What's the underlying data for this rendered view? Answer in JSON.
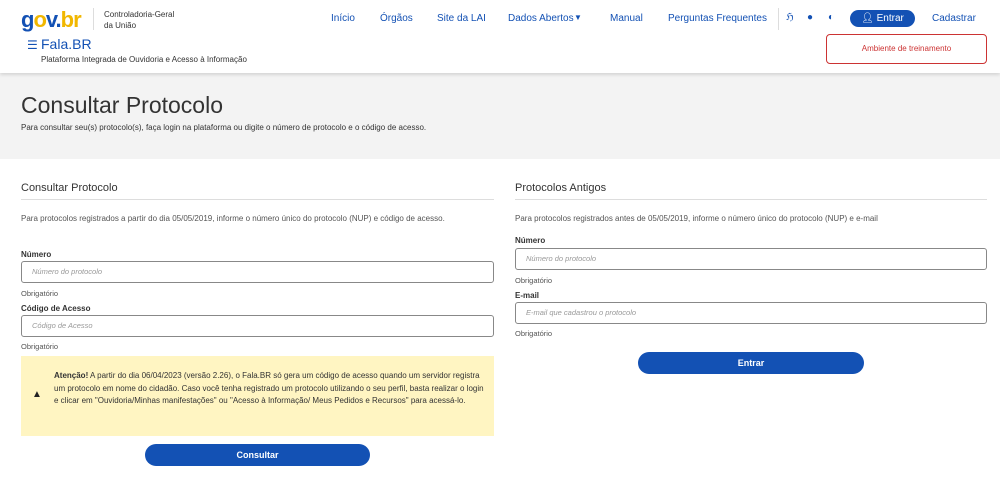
{
  "header": {
    "logo": "gov.br",
    "org_line1": "Controladoria-Geral",
    "org_line2": "da União",
    "app_name": "Fala.BR",
    "app_subtitle": "Plataforma Integrada de Ouvidoria e Acesso à Informação",
    "nav": [
      "Início",
      "Órgãos",
      "Site da LAI",
      "Dados Abertos",
      "Manual",
      "Perguntas Frequentes"
    ],
    "login_label": "Entrar",
    "register_label": "Cadastrar",
    "environment_label": "Ambiente de treinamento"
  },
  "page": {
    "title": "Consultar Protocolo",
    "description": "Para consultar seu(s) protocolo(s), faça login na plataforma ou digite o número de protocolo e o código de acesso."
  },
  "left": {
    "heading": "Consultar Protocolo",
    "info": "Para protocolos registrados a partir do dia 05/05/2019, informe o número único do protocolo (NUP) e código de acesso.",
    "numero_label": "Número",
    "numero_placeholder": "Número do protocolo",
    "required": "Obrigatório",
    "codigo_label": "Código de Acesso",
    "codigo_placeholder": "Código de Acesso",
    "alert_bold": "Atenção!",
    "alert_text": " A partir do dia 06/04/2023 (versão 2.26), o Fala.BR só gera um código de acesso quando um servidor registra um protocolo em nome do cidadão. Caso você tenha registrado um protocolo utilizando o seu perfil, basta realizar o login e clicar em \"Ouvidoria/Minhas manifestações\" ou \"Acesso à Informação/ Meus Pedidos e Recursos\" para acessá-lo.",
    "submit": "Consultar"
  },
  "right": {
    "heading": "Protocolos Antigos",
    "info": "Para protocolos registrados antes de 05/05/2019, informe o número único do protocolo (NUP) e e-mail",
    "numero_label": "Número",
    "numero_placeholder": "Número do protocolo",
    "required": "Obrigatório",
    "email_label": "E-mail",
    "email_placeholder": "E-mail que cadastrou o protocolo",
    "submit": "Entrar"
  }
}
